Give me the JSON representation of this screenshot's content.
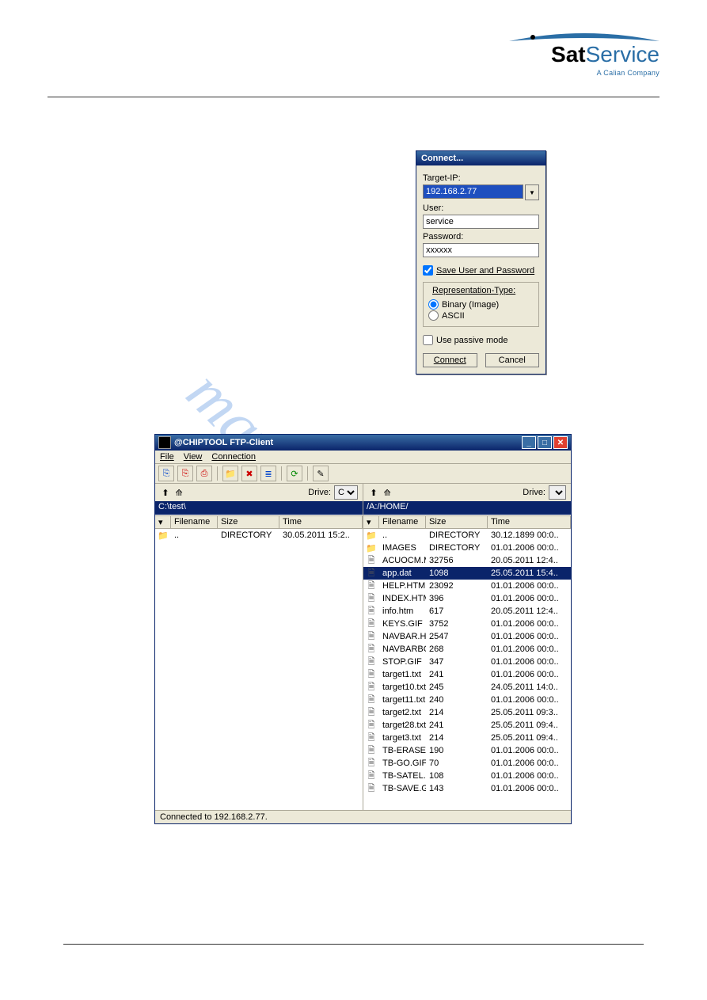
{
  "logo": {
    "sat": "Sat",
    "service": "Service",
    "sub": "A Calian Company"
  },
  "connect": {
    "title": "Connect...",
    "target_label": "Target-IP:",
    "target_value": "192.168.2.77",
    "user_label": "User:",
    "user_value": "service",
    "password_label": "Password:",
    "password_value": "xxxxxx",
    "save_label": "Save User and Password",
    "repr_title": "Representation-Type:",
    "binary_label": "Binary (Image)",
    "ascii_label": "ASCII",
    "passive_label": "Use passive mode",
    "connect_btn": "Connect",
    "cancel_btn": "Cancel"
  },
  "ftp": {
    "title": "@CHIPTOOL FTP-Client",
    "menu": {
      "file": "File",
      "view": "View",
      "connection": "Connection"
    },
    "drive_label": "Drive:",
    "left_drive": "C",
    "right_drive": "",
    "hdr": {
      "filename": "Filename",
      "size": "Size",
      "time": "Time"
    },
    "left_path": "C:\\test\\",
    "right_path": "/A:/HOME/",
    "status": "Connected to 192.168.2.77.",
    "left_rows": [
      {
        "name": "..",
        "type": "folder",
        "size": "DIRECTORY",
        "time": "30.05.2011 15:2.."
      }
    ],
    "right_rows": [
      {
        "name": "..",
        "type": "folder",
        "size": "DIRECTORY",
        "time": "30.12.1899 00:0.."
      },
      {
        "name": "IMAGES",
        "type": "folder",
        "size": "DIRECTORY",
        "time": "01.01.2006 00:0.."
      },
      {
        "name": "ACUOCM.MIB",
        "type": "file",
        "size": "32756",
        "time": "20.05.2011 12:4.."
      },
      {
        "name": "app.dat",
        "type": "file",
        "size": "1098",
        "time": "25.05.2011 15:4..",
        "selected": true
      },
      {
        "name": "HELP.HTM",
        "type": "file",
        "size": "23092",
        "time": "01.01.2006 00:0.."
      },
      {
        "name": "INDEX.HTM",
        "type": "file",
        "size": "396",
        "time": "01.01.2006 00:0.."
      },
      {
        "name": "info.htm",
        "type": "file",
        "size": "617",
        "time": "20.05.2011 12:4.."
      },
      {
        "name": "KEYS.GIF",
        "type": "file",
        "size": "3752",
        "time": "01.01.2006 00:0.."
      },
      {
        "name": "NAVBAR.HTM",
        "type": "file",
        "size": "2547",
        "time": "01.01.2006 00:0.."
      },
      {
        "name": "NAVBARBG.GIF",
        "type": "file",
        "size": "268",
        "time": "01.01.2006 00:0.."
      },
      {
        "name": "STOP.GIF",
        "type": "file",
        "size": "347",
        "time": "01.01.2006 00:0.."
      },
      {
        "name": "target1.txt",
        "type": "file",
        "size": "241",
        "time": "01.01.2006 00:0.."
      },
      {
        "name": "target10.txt",
        "type": "file",
        "size": "245",
        "time": "24.05.2011 14:0.."
      },
      {
        "name": "target11.txt",
        "type": "file",
        "size": "240",
        "time": "01.01.2006 00:0.."
      },
      {
        "name": "target2.txt",
        "type": "file",
        "size": "214",
        "time": "25.05.2011 09:3.."
      },
      {
        "name": "target28.txt",
        "type": "file",
        "size": "241",
        "time": "25.05.2011 09:4.."
      },
      {
        "name": "target3.txt",
        "type": "file",
        "size": "214",
        "time": "25.05.2011 09:4.."
      },
      {
        "name": "TB-ERASE.GIF",
        "type": "file",
        "size": "190",
        "time": "01.01.2006 00:0.."
      },
      {
        "name": "TB-GO.GIF",
        "type": "file",
        "size": "70",
        "time": "01.01.2006 00:0.."
      },
      {
        "name": "TB-SATEL.GIF",
        "type": "file",
        "size": "108",
        "time": "01.01.2006 00:0.."
      },
      {
        "name": "TB-SAVE.GIF",
        "type": "file",
        "size": "143",
        "time": "01.01.2006 00:0.."
      }
    ]
  },
  "watermark": "manualshive.com"
}
